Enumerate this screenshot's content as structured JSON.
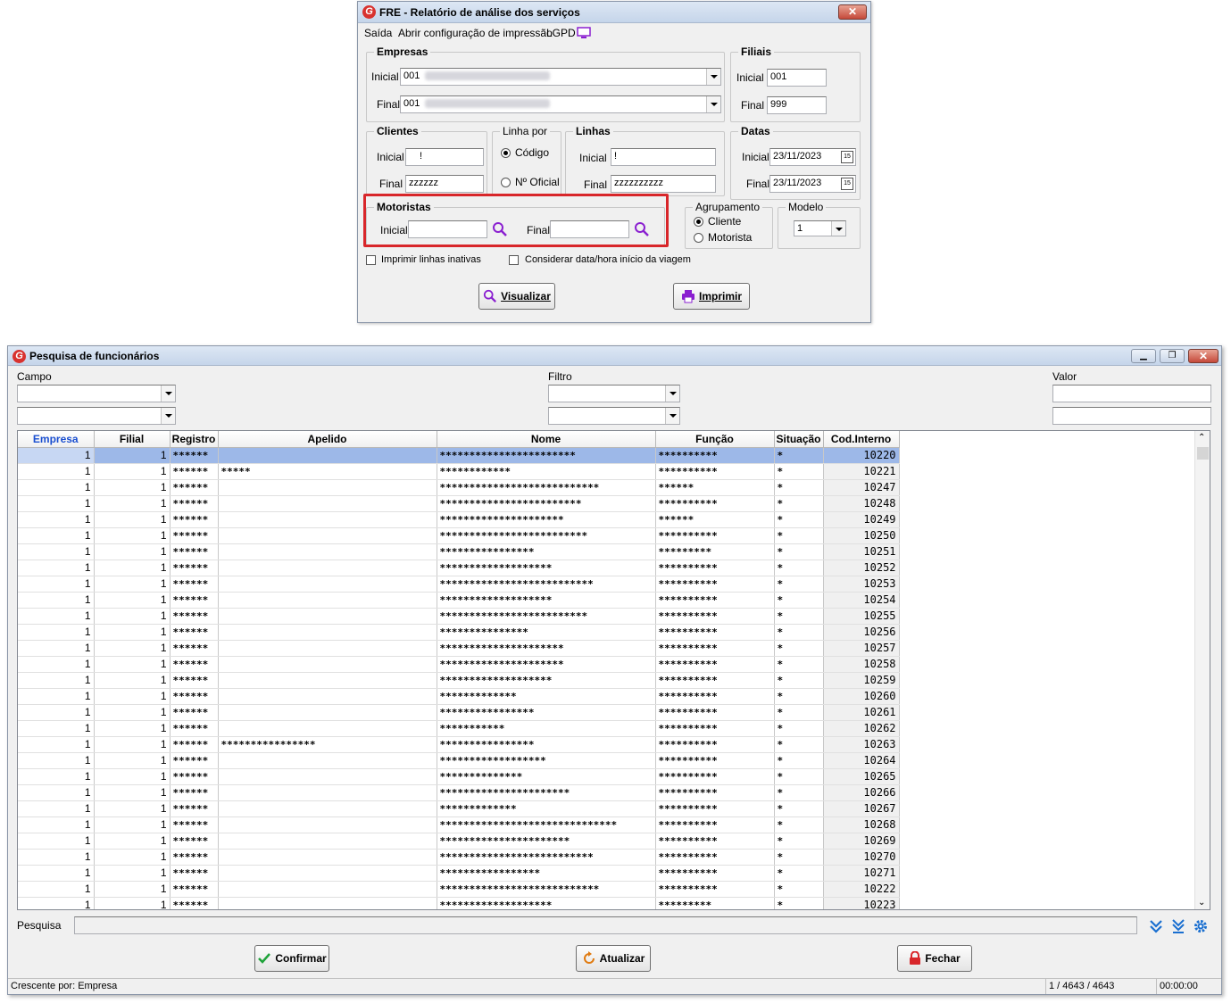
{
  "dialog": {
    "title": "FRE - Relatório de análise dos serviços",
    "close": "✕",
    "menu": [
      "Saída",
      "Abrir configuração de impressão",
      "LGPD"
    ],
    "empresas": {
      "title": "Empresas",
      "inicial_label": "Inicial",
      "inicial_value": "001",
      "final_label": "Final",
      "final_value": "001"
    },
    "filiais": {
      "title": "Filiais",
      "inicial_label": "Inicial",
      "inicial_value": "001",
      "final_label": "Final",
      "final_value": "999"
    },
    "clientes": {
      "title": "Clientes",
      "inicial_label": "Inicial",
      "inicial_value": "!",
      "final_label": "Final",
      "final_value": "zzzzzz"
    },
    "linha_por": {
      "title": "Linha por",
      "options": [
        "Código",
        "Nº Oficial"
      ],
      "selected": "Código"
    },
    "linhas": {
      "title": "Linhas",
      "inicial_label": "Inicial",
      "inicial_value": "!",
      "final_label": "Final",
      "final_value": "zzzzzzzzzz"
    },
    "datas": {
      "title": "Datas",
      "inicial_label": "Inicial",
      "inicial_value": "23/11/2023",
      "final_label": "Final",
      "final_value": "23/11/2023",
      "cal": "15"
    },
    "motoristas": {
      "title": "Motoristas",
      "inicial_label": "Inicial",
      "inicial_value": "",
      "final_label": "Final",
      "final_value": ""
    },
    "agrupamento": {
      "title": "Agrupamento",
      "options": [
        "Cliente",
        "Motorista"
      ],
      "selected": "Cliente"
    },
    "modelo": {
      "title": "Modelo",
      "value": "1"
    },
    "checks": {
      "imprimir_inativas": "Imprimir linhas inativas",
      "considerar_data": "Considerar data/hora início da viagem"
    },
    "buttons": {
      "visualizar": "Visualizar",
      "imprimir": "Imprimir"
    },
    "highlight_color": "#d8262a"
  },
  "search": {
    "title": "Pesquisa de funcionários",
    "labels": {
      "campo": "Campo",
      "filtro": "Filtro",
      "valor": "Valor",
      "pesquisa": "Pesquisa"
    },
    "columns": [
      "Empresa",
      "Filial",
      "Registro",
      "Apelido",
      "Nome",
      "Função",
      "Situação",
      "Cod.Interno"
    ],
    "sorted_column": "Empresa",
    "rows": [
      {
        "empresa": "1",
        "filial": "1",
        "registro": "******",
        "apelido": "",
        "nome": "***********************",
        "funcao": "**********",
        "situacao": "*",
        "cod": "10220"
      },
      {
        "empresa": "1",
        "filial": "1",
        "registro": "******",
        "apelido": "*****",
        "nome": "************",
        "funcao": "**********",
        "situacao": "*",
        "cod": "10221"
      },
      {
        "empresa": "1",
        "filial": "1",
        "registro": "******",
        "apelido": "",
        "nome": "***************************",
        "funcao": "******",
        "situacao": "*",
        "cod": "10247"
      },
      {
        "empresa": "1",
        "filial": "1",
        "registro": "******",
        "apelido": "",
        "nome": "************************",
        "funcao": "**********",
        "situacao": "*",
        "cod": "10248"
      },
      {
        "empresa": "1",
        "filial": "1",
        "registro": "******",
        "apelido": "",
        "nome": "*********************",
        "funcao": "******",
        "situacao": "*",
        "cod": "10249"
      },
      {
        "empresa": "1",
        "filial": "1",
        "registro": "******",
        "apelido": "",
        "nome": "*************************",
        "funcao": "**********",
        "situacao": "*",
        "cod": "10250"
      },
      {
        "empresa": "1",
        "filial": "1",
        "registro": "******",
        "apelido": "",
        "nome": "****************",
        "funcao": "*********",
        "situacao": "*",
        "cod": "10251"
      },
      {
        "empresa": "1",
        "filial": "1",
        "registro": "******",
        "apelido": "",
        "nome": "*******************",
        "funcao": "**********",
        "situacao": "*",
        "cod": "10252"
      },
      {
        "empresa": "1",
        "filial": "1",
        "registro": "******",
        "apelido": "",
        "nome": "**************************",
        "funcao": "**********",
        "situacao": "*",
        "cod": "10253"
      },
      {
        "empresa": "1",
        "filial": "1",
        "registro": "******",
        "apelido": "",
        "nome": "*******************",
        "funcao": "**********",
        "situacao": "*",
        "cod": "10254"
      },
      {
        "empresa": "1",
        "filial": "1",
        "registro": "******",
        "apelido": "",
        "nome": "*************************",
        "funcao": "**********",
        "situacao": "*",
        "cod": "10255"
      },
      {
        "empresa": "1",
        "filial": "1",
        "registro": "******",
        "apelido": "",
        "nome": "***************",
        "funcao": "**********",
        "situacao": "*",
        "cod": "10256"
      },
      {
        "empresa": "1",
        "filial": "1",
        "registro": "******",
        "apelido": "",
        "nome": "*********************",
        "funcao": "**********",
        "situacao": "*",
        "cod": "10257"
      },
      {
        "empresa": "1",
        "filial": "1",
        "registro": "******",
        "apelido": "",
        "nome": "*********************",
        "funcao": "**********",
        "situacao": "*",
        "cod": "10258"
      },
      {
        "empresa": "1",
        "filial": "1",
        "registro": "******",
        "apelido": "",
        "nome": "*******************",
        "funcao": "**********",
        "situacao": "*",
        "cod": "10259"
      },
      {
        "empresa": "1",
        "filial": "1",
        "registro": "******",
        "apelido": "",
        "nome": "*************",
        "funcao": "**********",
        "situacao": "*",
        "cod": "10260"
      },
      {
        "empresa": "1",
        "filial": "1",
        "registro": "******",
        "apelido": "",
        "nome": "****************",
        "funcao": "**********",
        "situacao": "*",
        "cod": "10261"
      },
      {
        "empresa": "1",
        "filial": "1",
        "registro": "******",
        "apelido": "",
        "nome": "***********",
        "funcao": "**********",
        "situacao": "*",
        "cod": "10262"
      },
      {
        "empresa": "1",
        "filial": "1",
        "registro": "******",
        "apelido": "****************",
        "nome": "****************",
        "funcao": "**********",
        "situacao": "*",
        "cod": "10263"
      },
      {
        "empresa": "1",
        "filial": "1",
        "registro": "******",
        "apelido": "",
        "nome": "******************",
        "funcao": "**********",
        "situacao": "*",
        "cod": "10264"
      },
      {
        "empresa": "1",
        "filial": "1",
        "registro": "******",
        "apelido": "",
        "nome": "**************",
        "funcao": "**********",
        "situacao": "*",
        "cod": "10265"
      },
      {
        "empresa": "1",
        "filial": "1",
        "registro": "******",
        "apelido": "",
        "nome": "**********************",
        "funcao": "**********",
        "situacao": "*",
        "cod": "10266"
      },
      {
        "empresa": "1",
        "filial": "1",
        "registro": "******",
        "apelido": "",
        "nome": "*************",
        "funcao": "**********",
        "situacao": "*",
        "cod": "10267"
      },
      {
        "empresa": "1",
        "filial": "1",
        "registro": "******",
        "apelido": "",
        "nome": "******************************",
        "funcao": "**********",
        "situacao": "*",
        "cod": "10268"
      },
      {
        "empresa": "1",
        "filial": "1",
        "registro": "******",
        "apelido": "",
        "nome": "**********************",
        "funcao": "**********",
        "situacao": "*",
        "cod": "10269"
      },
      {
        "empresa": "1",
        "filial": "1",
        "registro": "******",
        "apelido": "",
        "nome": "**************************",
        "funcao": "**********",
        "situacao": "*",
        "cod": "10270"
      },
      {
        "empresa": "1",
        "filial": "1",
        "registro": "******",
        "apelido": "",
        "nome": "*****************",
        "funcao": "**********",
        "situacao": "*",
        "cod": "10271"
      },
      {
        "empresa": "1",
        "filial": "1",
        "registro": "******",
        "apelido": "",
        "nome": "***************************",
        "funcao": "**********",
        "situacao": "*",
        "cod": "10222"
      },
      {
        "empresa": "1",
        "filial": "1",
        "registro": "******",
        "apelido": "",
        "nome": "*******************",
        "funcao": "*********",
        "situacao": "*",
        "cod": "10223"
      }
    ],
    "buttons": {
      "confirmar": "Confirmar",
      "atualizar": "Atualizar",
      "fechar": "Fechar"
    },
    "status": {
      "order": "Crescente por: Empresa",
      "count": "1 / 4643 / 4643",
      "time": "00:00:00"
    },
    "accent_color": "#1a6fd0"
  }
}
